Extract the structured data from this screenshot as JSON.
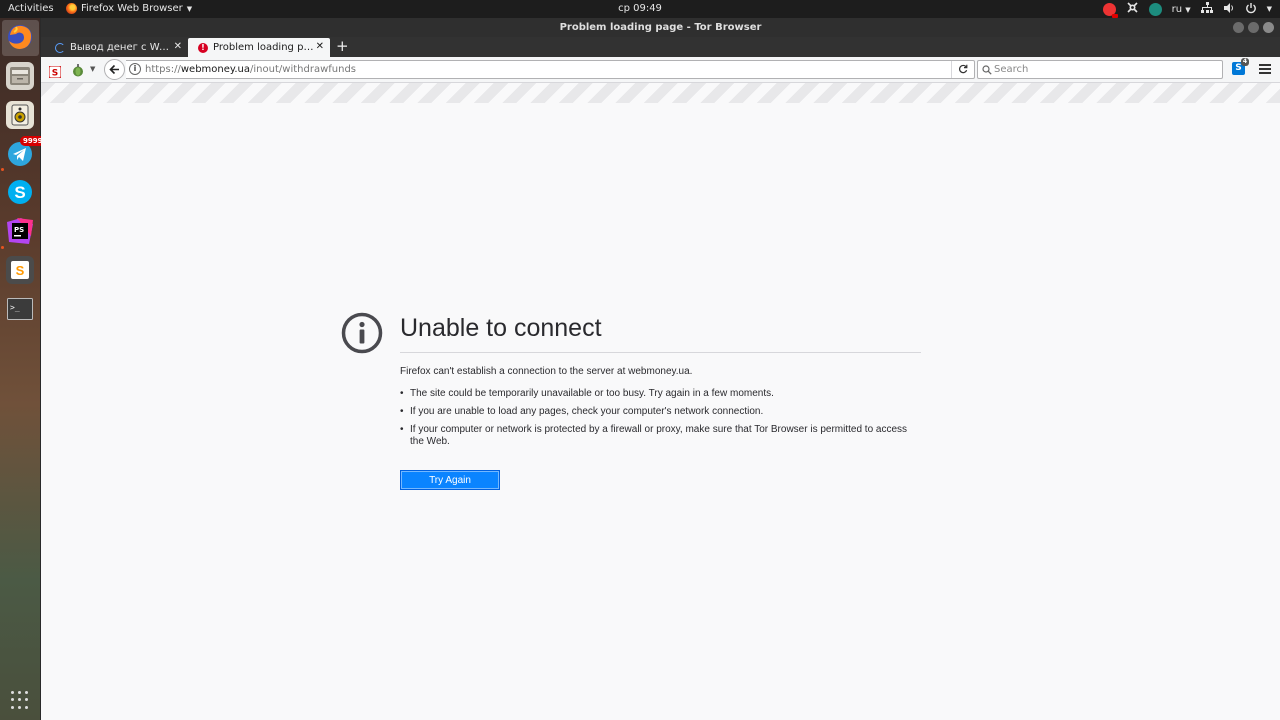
{
  "topbar": {
    "activities": "Activities",
    "app_menu": "Firefox Web Browser",
    "clock": "ср 09:49",
    "language": "ru"
  },
  "dock": {
    "items": [
      {
        "name": "firefox",
        "icon": "firefox-icon"
      },
      {
        "name": "files",
        "icon": "file-manager-icon"
      },
      {
        "name": "rhythmbox",
        "icon": "speaker-icon"
      },
      {
        "name": "telegram",
        "icon": "telegram-icon",
        "badge": "9999"
      },
      {
        "name": "skype",
        "icon": "skype-icon"
      },
      {
        "name": "phpstorm",
        "icon": "phpstorm-icon"
      },
      {
        "name": "sublime",
        "icon": "sublime-text-icon"
      },
      {
        "name": "terminal",
        "icon": "terminal-icon"
      }
    ],
    "apps_grid_icon": "show-applications-icon"
  },
  "window": {
    "title": "Problem loading page - Tor Browser"
  },
  "tabs": [
    {
      "label": "Вывод денег с Web…",
      "state": "loading"
    },
    {
      "label": "Problem loading page",
      "state": "error"
    }
  ],
  "navbar": {
    "url_scheme": "https://",
    "url_host": "webmoney.ua",
    "url_path": "/inout/withdrawfunds",
    "search_placeholder": "Search",
    "extension_badge": "4"
  },
  "error": {
    "title": "Unable to connect",
    "lead": "Firefox can't establish a connection to the server at webmoney.ua.",
    "bullets": [
      "The site could be temporarily unavailable or too busy. Try again in a few moments.",
      "If you are unable to load any pages, check your computer's network connection.",
      "If your computer or network is protected by a firewall or proxy, make sure that Tor Browser is permitted to access the Web."
    ],
    "button": "Try Again"
  },
  "colors": {
    "accent": "#0a84ff",
    "error_red": "#d70022",
    "topbar_bg": "#1d1d1d"
  }
}
